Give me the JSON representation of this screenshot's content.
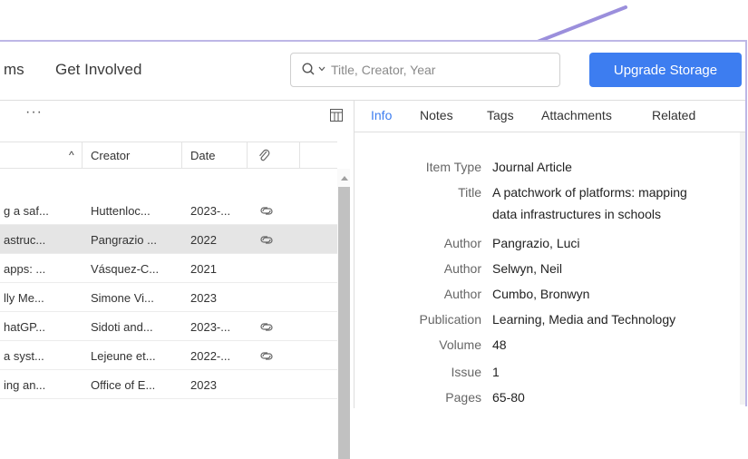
{
  "nav": {
    "links": [
      "ms",
      "Get Involved"
    ],
    "search_placeholder": "Title, Creator, Year",
    "upgrade_label": "Upgrade Storage"
  },
  "toolbar": {
    "more_label": "···"
  },
  "table": {
    "columns": {
      "sort_indicator": "^",
      "creator": "Creator",
      "date": "Date"
    },
    "rows": [
      {
        "title": "g a saf...",
        "creator": "Huttenloc...",
        "date": "2023-...",
        "attachment": true,
        "selected": false
      },
      {
        "title": "astruc...",
        "creator": "Pangrazio ...",
        "date": "2022",
        "attachment": true,
        "selected": true
      },
      {
        "title": "apps: ...",
        "creator": "Vásquez-C...",
        "date": "2021",
        "attachment": false,
        "selected": false
      },
      {
        "title": "lly Me...",
        "creator": "Simone Vi...",
        "date": "2023",
        "attachment": false,
        "selected": false
      },
      {
        "title": "hatGP...",
        "creator": "Sidoti and...",
        "date": "2023-...",
        "attachment": true,
        "selected": false
      },
      {
        "title": "a syst...",
        "creator": "Lejeune et...",
        "date": "2022-...",
        "attachment": true,
        "selected": false
      },
      {
        "title": "ing an...",
        "creator": "Office of E...",
        "date": "2023",
        "attachment": false,
        "selected": false
      }
    ]
  },
  "tabs": [
    "Info",
    "Notes",
    "Tags",
    "Attachments",
    "Related"
  ],
  "info": {
    "item_type_label": "Item Type",
    "item_type": "Journal Article",
    "title_label": "Title",
    "title_line1": "A patchwork of platforms: mapping",
    "title_line2": "data infrastructures in schools",
    "author_label": "Author",
    "authors": [
      "Pangrazio, Luci",
      "Selwyn, Neil",
      "Cumbo, Bronwyn"
    ],
    "publication_label": "Publication",
    "publication": "Learning, Media and Technology",
    "volume_label": "Volume",
    "volume": "48",
    "issue_label": "Issue",
    "issue": "1",
    "pages_label": "Pages",
    "pages": "65-80"
  },
  "colors": {
    "accent": "#3d7df0",
    "annotation_arrow": "#9b8fdc"
  }
}
